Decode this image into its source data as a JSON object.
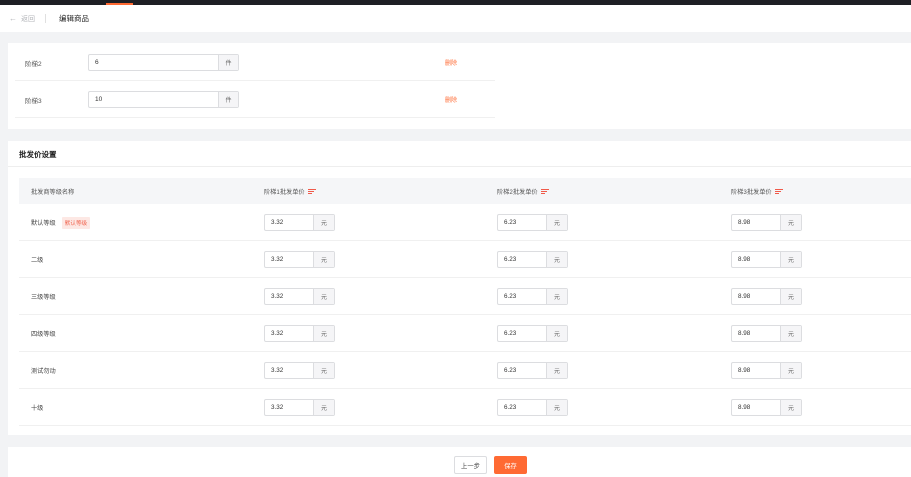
{
  "header": {
    "back_label": "返回",
    "title": "编辑商品"
  },
  "tiers": [
    {
      "label": "阶梯2",
      "value": "6",
      "unit": "件",
      "delete_label": "删除"
    },
    {
      "label": "阶梯3",
      "value": "10",
      "unit": "件",
      "delete_label": "删除"
    }
  ],
  "price_section": {
    "title": "批发价设置",
    "columns": [
      "批发商等级名称",
      "阶梯1批发单价",
      "阶梯2批发单价",
      "阶梯3批发单价"
    ],
    "unit": "元",
    "rows": [
      {
        "name": "默认等级",
        "badge": "默认等级",
        "prices": [
          "3.32",
          "6.23",
          "8.98"
        ]
      },
      {
        "name": "二级",
        "prices": [
          "3.32",
          "6.23",
          "8.98"
        ]
      },
      {
        "name": "三级等级",
        "prices": [
          "3.32",
          "6.23",
          "8.98"
        ]
      },
      {
        "name": "四级等级",
        "prices": [
          "3.32",
          "6.23",
          "8.98"
        ]
      },
      {
        "name": "测试勿动",
        "prices": [
          "3.32",
          "6.23",
          "8.98"
        ]
      },
      {
        "name": "十级",
        "prices": [
          "3.32",
          "6.23",
          "8.98"
        ]
      }
    ]
  },
  "footer": {
    "prev_label": "上一步",
    "save_label": "保存"
  },
  "colors": {
    "accent": "#ff6a33",
    "badge_bg": "#fde8e4",
    "badge_text": "#f0644f"
  }
}
